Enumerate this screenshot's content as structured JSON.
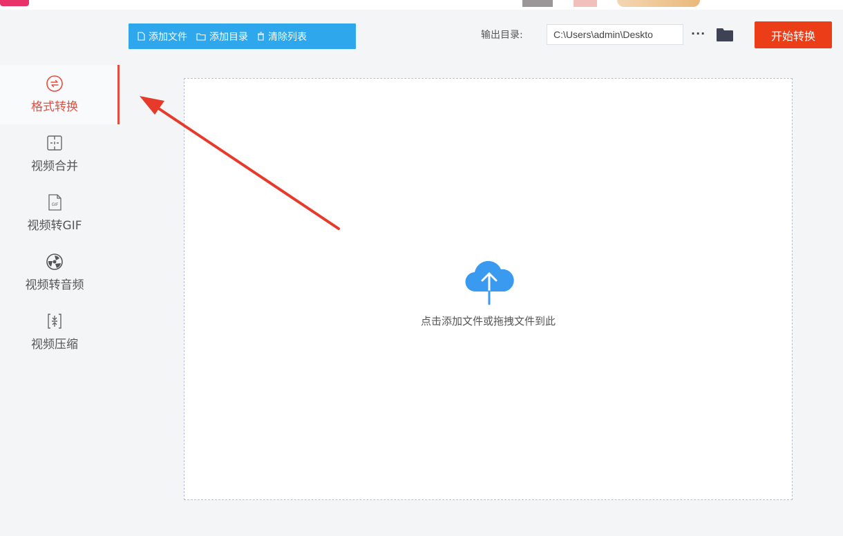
{
  "sidebar": {
    "items": [
      {
        "label": "格式转换",
        "icon": "format-convert-icon",
        "active": true
      },
      {
        "label": "视频合并",
        "icon": "video-merge-icon",
        "active": false
      },
      {
        "label": "视频转GIF",
        "icon": "gif-icon",
        "active": false
      },
      {
        "label": "视频转音频",
        "icon": "audio-icon",
        "active": false
      },
      {
        "label": "视频压缩",
        "icon": "compress-icon",
        "active": false
      }
    ]
  },
  "toolbar": {
    "add_file": "添加文件",
    "add_dir": "添加目录",
    "clear_list": "清除列表",
    "output_label": "输出目录:",
    "output_path": "C:\\Users\\admin\\Deskto",
    "more": "···",
    "start": "开始转换"
  },
  "dropzone": {
    "hint": "点击添加文件或拖拽文件到此"
  },
  "colors": {
    "accent_red": "#e74c3c",
    "toolbar_blue": "#2ea7ec",
    "start_orange": "#ea3d18",
    "cloud_blue": "#3a9af0"
  }
}
